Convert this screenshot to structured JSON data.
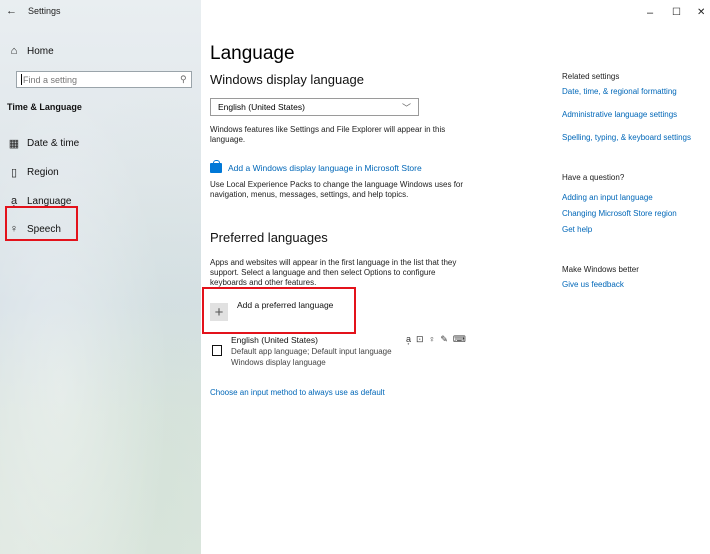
{
  "window": {
    "title": "Settings",
    "controls": {
      "minimize": "–",
      "maximize": "☐",
      "close": "✕"
    }
  },
  "sidebar": {
    "home_label": "Home",
    "search_placeholder": "Find a setting",
    "section_title": "Time & Language",
    "items": [
      {
        "label": "Date & time",
        "icon": "calendar-clock-icon"
      },
      {
        "label": "Region",
        "icon": "region-icon"
      },
      {
        "label": "Language",
        "icon": "language-icon"
      },
      {
        "label": "Speech",
        "icon": "microphone-icon"
      }
    ]
  },
  "main": {
    "page_title": "Language",
    "display_language": {
      "heading": "Windows display language",
      "selected": "English (United States)",
      "description": "Windows features like Settings and File Explorer will appear in this language.",
      "store_link": "Add a Windows display language in Microsoft Store",
      "local_experience_text": "Use Local Experience Packs to change the language Windows uses for navigation, menus, messages, settings, and help topics."
    },
    "preferred": {
      "heading": "Preferred languages",
      "description": "Apps and websites will appear in the first language in the list that they support. Select a language and then select Options to configure keyboards and other features.",
      "add_label": "Add a preferred language",
      "add_icon": "+",
      "languages": [
        {
          "name": "English (United States)",
          "line1": "Default app language; Default input language",
          "line2": "Windows display language"
        }
      ]
    },
    "input_method_link": "Choose an input method to always use as default"
  },
  "right": {
    "related_heading": "Related settings",
    "related_links": [
      "Date, time, & regional formatting",
      "Administrative language settings",
      "Spelling, typing, & keyboard settings"
    ],
    "question_heading": "Have a question?",
    "question_links": [
      "Adding an input language",
      "Changing Microsoft Store region",
      "Get help"
    ],
    "better_heading": "Make Windows better",
    "feedback_link": "Give us feedback"
  },
  "colors": {
    "accent": "#0067b8",
    "highlight": "#e3121b"
  }
}
